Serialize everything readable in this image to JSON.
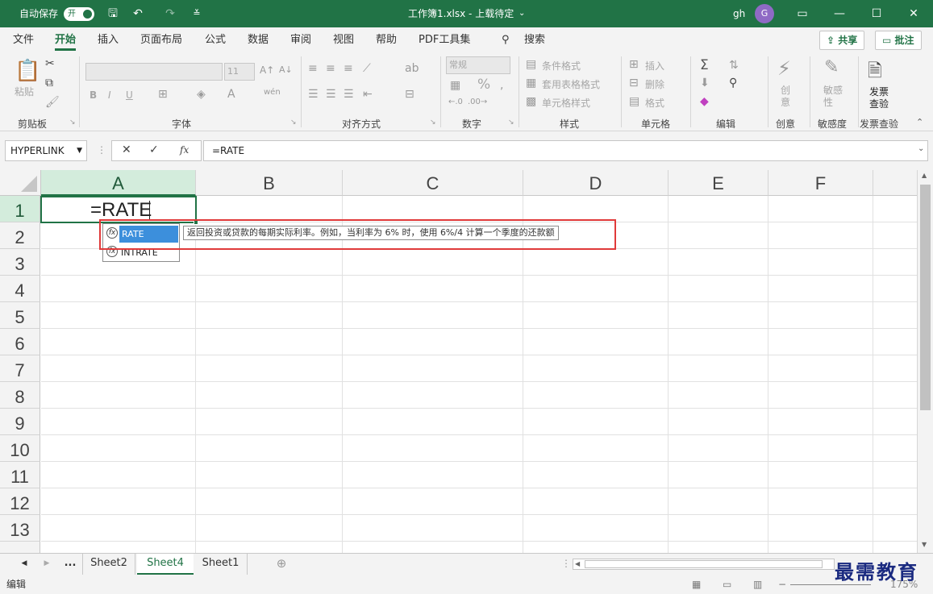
{
  "titlebar": {
    "autosave_label": "自动保存",
    "autosave_state": "开",
    "doc_title": "工作簿1.xlsx - 上载待定",
    "title_caret": "⌄",
    "user": "gh",
    "avatar_letter": "G"
  },
  "menu": {
    "tabs": [
      "文件",
      "开始",
      "插入",
      "页面布局",
      "公式",
      "数据",
      "审阅",
      "视图",
      "帮助",
      "PDF工具集"
    ],
    "search": "搜索",
    "share": "共享",
    "comment": "批注"
  },
  "ribbon": {
    "clipboard": {
      "paste": "粘贴",
      "label": "剪贴板"
    },
    "font": {
      "size": "11",
      "label": "字体",
      "bold": "B",
      "italic": "I",
      "underline": "U"
    },
    "align": {
      "label": "对齐方式"
    },
    "number": {
      "format": "常规",
      "label": "数字",
      "percent": "%"
    },
    "styles": {
      "cond": "条件格式",
      "table": "套用表格格式",
      "cell": "单元格样式",
      "label": "样式"
    },
    "cells": {
      "insert": "插入",
      "delete": "删除",
      "format": "格式",
      "label": "单元格"
    },
    "edit": {
      "label": "编辑"
    },
    "creative": {
      "btn": "创\n意",
      "label": "创意"
    },
    "sensitivity": {
      "btn": "敏感\n性",
      "label": "敏感度"
    },
    "invoice": {
      "btn1": "发票",
      "btn2": "查验",
      "label": "发票查验"
    }
  },
  "formulabar": {
    "namebox": "HYPERLINK",
    "formula": "=RATE",
    "fx": "fx"
  },
  "grid": {
    "columns": [
      "A",
      "B",
      "C",
      "D",
      "E",
      "F"
    ],
    "rows": [
      "1",
      "2",
      "3",
      "4",
      "5",
      "6",
      "7",
      "8",
      "9",
      "10",
      "11",
      "12",
      "13"
    ],
    "active_cell_text": "=RATE"
  },
  "autocomplete": {
    "items": [
      "RATE",
      "INTRATE"
    ],
    "tooltip": "返回投资或贷款的每期实际利率。例如，当利率为 6% 时，使用 6%/4 计算一个季度的还款额"
  },
  "sheets": {
    "ellipsis": "...",
    "tabs": [
      "Sheet2",
      "Sheet4",
      "Sheet1"
    ],
    "active": "Sheet4"
  },
  "status": {
    "mode": "编辑",
    "zoom": "175%"
  },
  "watermark": "最需教育",
  "colors": {
    "accent": "#217346",
    "highlight": "#e03a3a",
    "selection": "#3c8fdc"
  }
}
